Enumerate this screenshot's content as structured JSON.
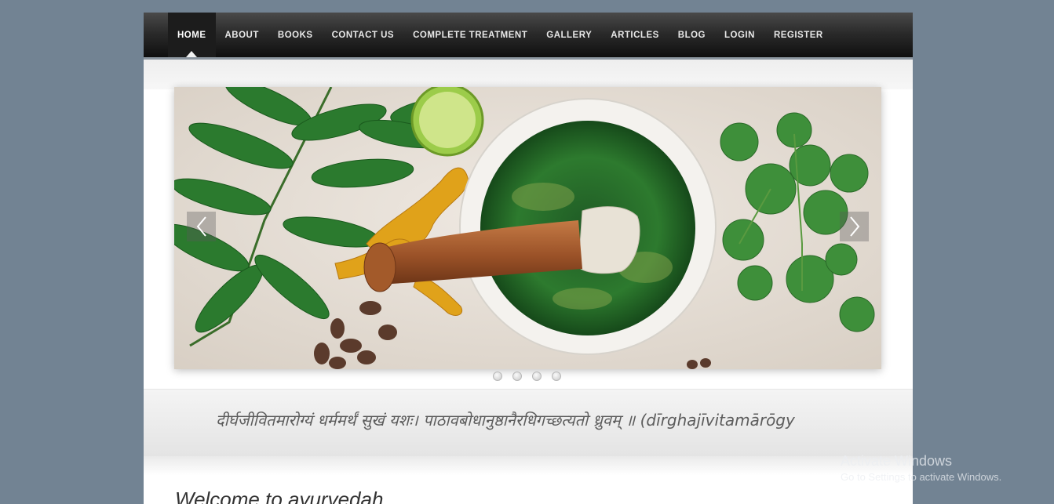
{
  "nav": {
    "items": [
      {
        "label": "HOME",
        "active": true
      },
      {
        "label": "ABOUT"
      },
      {
        "label": "BOOKS"
      },
      {
        "label": "CONTACT US"
      },
      {
        "label": "COMPLETE TREATMENT"
      },
      {
        "label": "GALLERY"
      },
      {
        "label": "ARTICLES"
      },
      {
        "label": "BLOG"
      },
      {
        "label": "LOGIN"
      },
      {
        "label": "REGISTER"
      }
    ]
  },
  "slider": {
    "image_icon": "mortar-pestle-herbs-photo",
    "prev_icon": "chevron-left-icon",
    "next_icon": "chevron-right-icon",
    "slide_count": 4
  },
  "quote": {
    "text": "दीर्घजीवितमारोग्यं धर्ममर्थं सुखं यशः।  पाठावबोधानुष्ठानैरधिगच्छत्यतो ध्रुवम् ॥ (dīrghajīvitamārōgy"
  },
  "welcome": {
    "title": "Welcome to ayurvedah"
  },
  "watermark": {
    "title": "Activate Windows",
    "subtitle": "Go to Settings to activate Windows."
  },
  "colors": {
    "background": "#728393",
    "nav_dark": "#1c1c1c",
    "nav_text": "#e8e8e8"
  }
}
